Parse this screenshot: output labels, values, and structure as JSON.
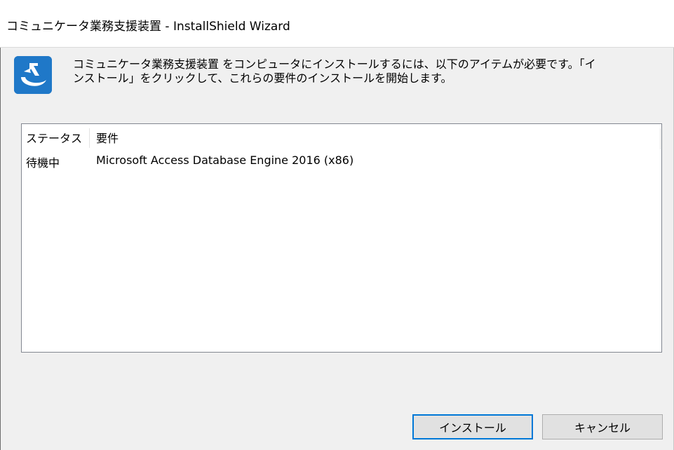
{
  "window": {
    "title": "コミュニケータ業務支援装置 - InstallShield Wizard"
  },
  "message": {
    "line1": "コミュニケータ業務支援装置 をコンピュータにインストールするには、以下のアイテムが必要です。「イ",
    "line2": "ンストール」をクリックして、これらの要件のインストールを開始します。"
  },
  "requirements": {
    "columns": [
      "ステータス",
      "要件"
    ],
    "rows": [
      {
        "status": "待機中",
        "requirement": "Microsoft Access Database Engine 2016 (x86)"
      }
    ]
  },
  "buttons": {
    "install_label": "インストール",
    "cancel_label": "キャンセル"
  },
  "colors": {
    "accent": "#0078d7",
    "icon_bg": "#1f78c8",
    "dialog_bg": "#f0f0f0"
  },
  "icons": {
    "app": "setup-app-icon"
  }
}
